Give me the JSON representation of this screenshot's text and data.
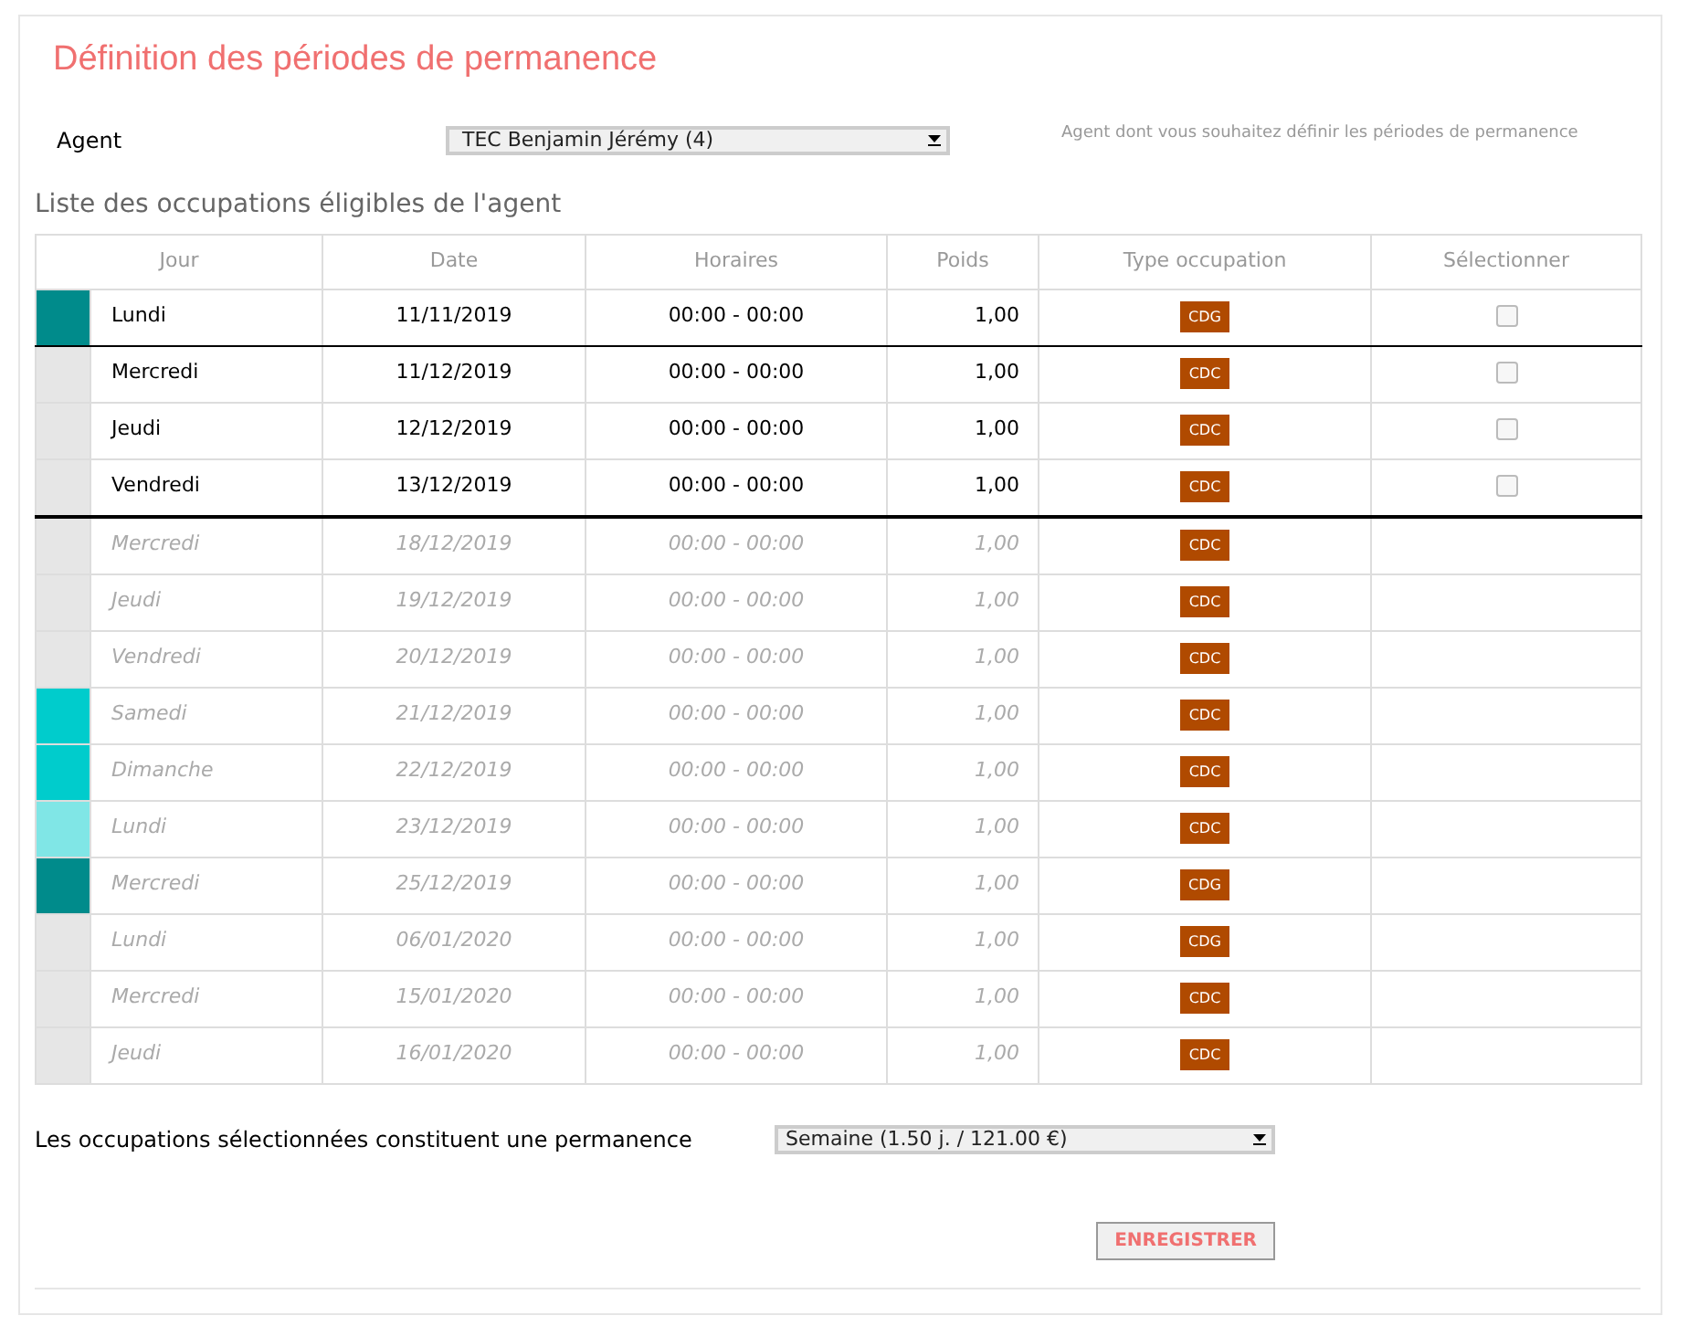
{
  "title": "Définition des périodes de permanence",
  "agent": {
    "label": "Agent",
    "value": "TEC Benjamin Jérémy (4)",
    "hint": "Agent dont vous souhaitez définir les périodes de permanence"
  },
  "list_title": "Liste des occupations éligibles de l'agent",
  "table": {
    "columns": [
      "Jour",
      "Date",
      "Horaires",
      "Poids",
      "Type occupation",
      "Sélectionner"
    ],
    "rows": [
      {
        "color": "#008b8b",
        "jour": "Lundi",
        "date": "11/11/2019",
        "horaires": "00:00 - 00:00",
        "poids": "1,00",
        "type": "CDG",
        "eligible": true,
        "checked": false,
        "rule_below": true,
        "bold_rule": false
      },
      {
        "color": "#e6e6e6",
        "jour": "Mercredi",
        "date": "11/12/2019",
        "horaires": "00:00 - 00:00",
        "poids": "1,00",
        "type": "CDC",
        "eligible": true,
        "checked": false
      },
      {
        "color": "#e6e6e6",
        "jour": "Jeudi",
        "date": "12/12/2019",
        "horaires": "00:00 - 00:00",
        "poids": "1,00",
        "type": "CDC",
        "eligible": true,
        "checked": false
      },
      {
        "color": "#e6e6e6",
        "jour": "Vendredi",
        "date": "13/12/2019",
        "horaires": "00:00 - 00:00",
        "poids": "1,00",
        "type": "CDC",
        "eligible": true,
        "checked": false,
        "rule_below": true,
        "bold_rule": true
      },
      {
        "color": "#e6e6e6",
        "jour": "Mercredi",
        "date": "18/12/2019",
        "horaires": "00:00 - 00:00",
        "poids": "1,00",
        "type": "CDC",
        "eligible": false
      },
      {
        "color": "#e6e6e6",
        "jour": "Jeudi",
        "date": "19/12/2019",
        "horaires": "00:00 - 00:00",
        "poids": "1,00",
        "type": "CDC",
        "eligible": false
      },
      {
        "color": "#e6e6e6",
        "jour": "Vendredi",
        "date": "20/12/2019",
        "horaires": "00:00 - 00:00",
        "poids": "1,00",
        "type": "CDC",
        "eligible": false
      },
      {
        "color": "#00cccc",
        "jour": "Samedi",
        "date": "21/12/2019",
        "horaires": "00:00 - 00:00",
        "poids": "1,00",
        "type": "CDC",
        "eligible": false
      },
      {
        "color": "#00cccc",
        "jour": "Dimanche",
        "date": "22/12/2019",
        "horaires": "00:00 - 00:00",
        "poids": "1,00",
        "type": "CDC",
        "eligible": false
      },
      {
        "color": "#80e6e6",
        "jour": "Lundi",
        "date": "23/12/2019",
        "horaires": "00:00 - 00:00",
        "poids": "1,00",
        "type": "CDC",
        "eligible": false
      },
      {
        "color": "#008b8b",
        "jour": "Mercredi",
        "date": "25/12/2019",
        "horaires": "00:00 - 00:00",
        "poids": "1,00",
        "type": "CDG",
        "eligible": false
      },
      {
        "color": "#e6e6e6",
        "jour": "Lundi",
        "date": "06/01/2020",
        "horaires": "00:00 - 00:00",
        "poids": "1,00",
        "type": "CDG",
        "eligible": false
      },
      {
        "color": "#e6e6e6",
        "jour": "Mercredi",
        "date": "15/01/2020",
        "horaires": "00:00 - 00:00",
        "poids": "1,00",
        "type": "CDC",
        "eligible": false
      },
      {
        "color": "#e6e6e6",
        "jour": "Jeudi",
        "date": "16/01/2020",
        "horaires": "00:00 - 00:00",
        "poids": "1,00",
        "type": "CDC",
        "eligible": false
      }
    ]
  },
  "permanence": {
    "label": "Les occupations sélectionnées constituent une permanence",
    "value": "Semaine (1.50 j. / 121.00 €)"
  },
  "save_button": "ENREGISTRER"
}
